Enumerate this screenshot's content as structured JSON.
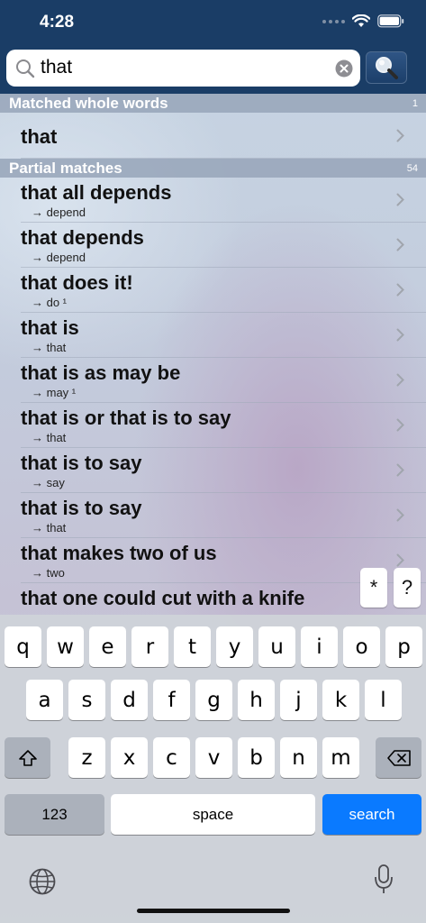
{
  "status": {
    "time": "4:28"
  },
  "search": {
    "query": "that"
  },
  "sections": [
    {
      "title": "Matched whole words",
      "count": "1",
      "rows": [
        {
          "title": "that",
          "sub": ""
        }
      ]
    },
    {
      "title": "Partial matches",
      "count": "54",
      "rows": [
        {
          "title": "that all depends",
          "sub": "→ depend"
        },
        {
          "title": "that depends",
          "sub": "→ depend"
        },
        {
          "title": "that does it!",
          "sub": "→ do ¹"
        },
        {
          "title": "that is",
          "sub": "→ that"
        },
        {
          "title": "that is as may be",
          "sub": "→ may ¹"
        },
        {
          "title": "that is or that is to say",
          "sub": "→ that"
        },
        {
          "title": "that is to say",
          "sub": "→ say"
        },
        {
          "title": "that is to say",
          "sub": "→ that"
        },
        {
          "title": "that makes two of us",
          "sub": "→ two"
        },
        {
          "title": "that one could cut with a knife",
          "sub": ""
        }
      ]
    }
  ],
  "wildcards": [
    "*",
    "?"
  ],
  "keyboard": {
    "row1": [
      "q",
      "w",
      "e",
      "r",
      "t",
      "y",
      "u",
      "i",
      "o",
      "p"
    ],
    "row2": [
      "a",
      "s",
      "d",
      "f",
      "g",
      "h",
      "j",
      "k",
      "l"
    ],
    "row3": [
      "z",
      "x",
      "c",
      "v",
      "b",
      "n",
      "m"
    ],
    "numbers_label": "123",
    "space_label": "space",
    "search_label": "search"
  },
  "colors": {
    "header": "#1a3d66",
    "accent": "#0a7aff"
  }
}
